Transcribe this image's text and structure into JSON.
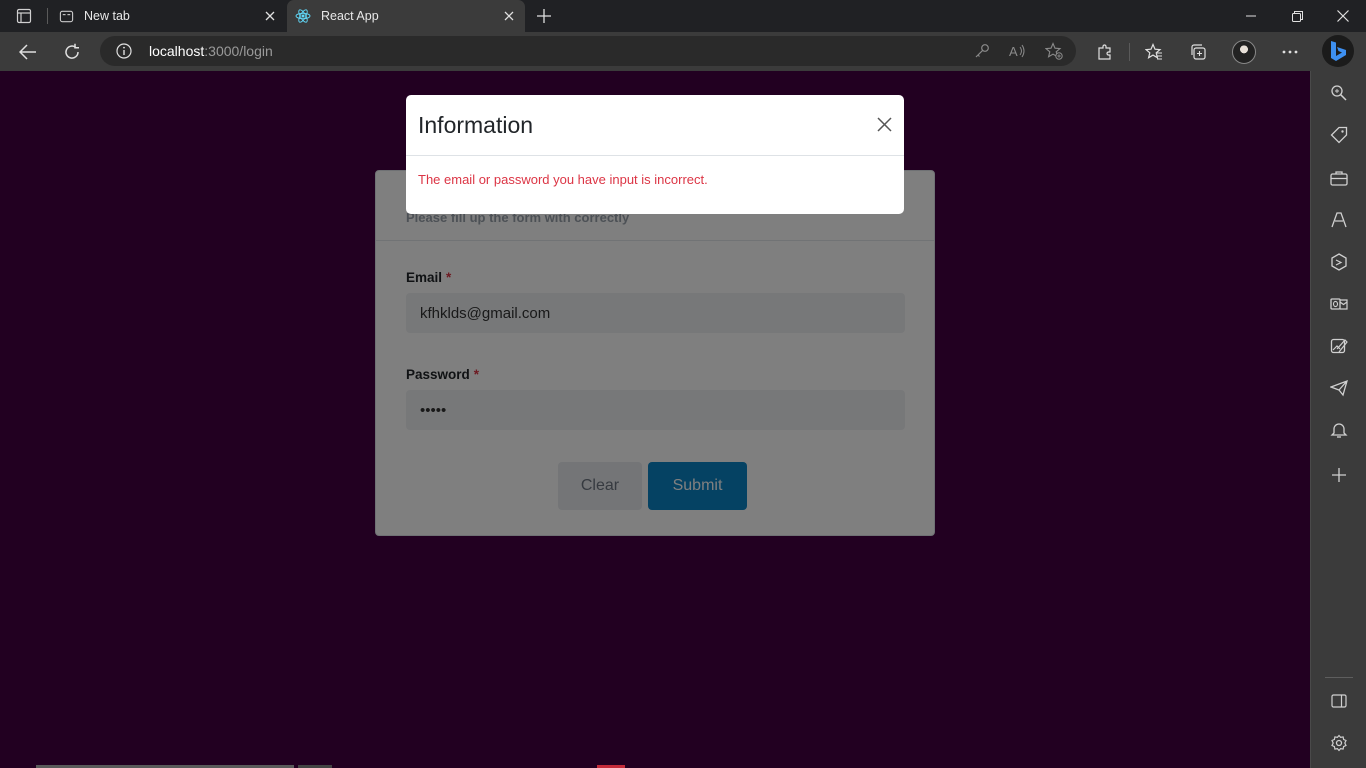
{
  "browser": {
    "tabs": [
      {
        "label": "New tab",
        "active": false,
        "icon": "new-tab-page-icon"
      },
      {
        "label": "React App",
        "active": true,
        "icon": "react-logo-icon"
      }
    ],
    "address_bar": {
      "url_host": "localhost",
      "url_path": ":3000/login"
    },
    "icons": {
      "toolbar": [
        "back-arrow-icon",
        "refresh-icon",
        "site-info-icon",
        "password-key-icon",
        "read-aloud-icon",
        "add-favorite-icon",
        "extensions-icon",
        "favorites-icon",
        "collections-icon",
        "profile-avatar",
        "more-menu-icon",
        "copilot-icon"
      ],
      "sidebar": [
        "search-icon",
        "shopping-tag-icon",
        "tools-briefcase-icon",
        "games-icon",
        "microsoft-365-icon",
        "outlook-icon",
        "designer-icon",
        "drop-send-icon",
        "bell-icon",
        "add-icon",
        "sidebar-toggle-icon",
        "settings-gear-icon"
      ]
    }
  },
  "login_form": {
    "subtitle": "Please fill up the form with correctly",
    "email": {
      "label": "Email",
      "required_mark": "*",
      "value": "kfhklds@gmail.com"
    },
    "password": {
      "label": "Password",
      "required_mark": "*",
      "value": "•••••"
    },
    "clear_label": "Clear",
    "submit_label": "Submit"
  },
  "modal": {
    "title": "Information",
    "message": "The email or password you have input is incorrect."
  },
  "colors": {
    "page_background": "#440043",
    "submit_button": "#0a84c6",
    "error_text": "#dc3545"
  }
}
